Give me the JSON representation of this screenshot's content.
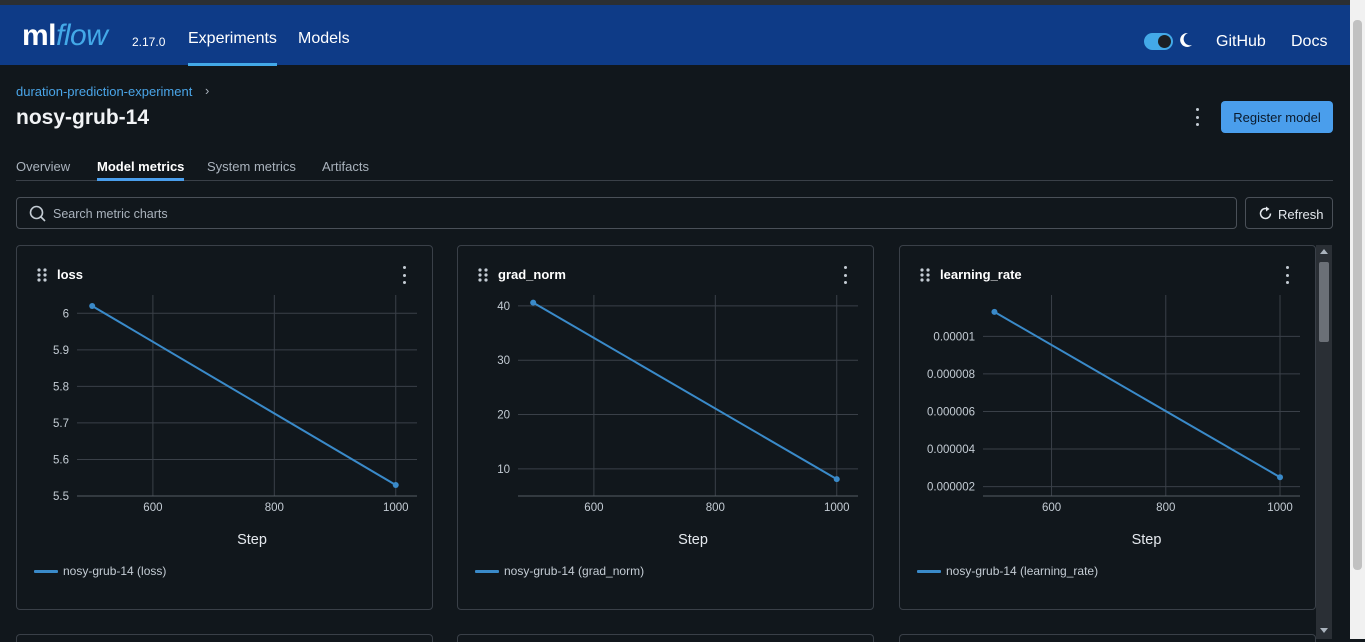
{
  "header": {
    "logo_main": "ml",
    "logo_flow": "flow",
    "version": "2.17.0",
    "nav": [
      {
        "label": "Experiments",
        "active": true
      },
      {
        "label": "Models",
        "active": false
      }
    ],
    "theme_toggle_on": true,
    "links": [
      "GitHub",
      "Docs"
    ]
  },
  "breadcrumb": {
    "experiment": "duration-prediction-experiment"
  },
  "run": {
    "name": "nosy-grub-14",
    "register_label": "Register model"
  },
  "tabs": [
    {
      "label": "Overview",
      "active": false
    },
    {
      "label": "Model metrics",
      "active": true
    },
    {
      "label": "System metrics",
      "active": false
    },
    {
      "label": "Artifacts",
      "active": false
    }
  ],
  "search": {
    "placeholder": "Search metric charts"
  },
  "refresh_label": "Refresh",
  "colors": {
    "accent": "#43a9e8",
    "series": "#3a8ac9",
    "header_bg": "#0e3b87"
  },
  "chart_data": [
    {
      "type": "line",
      "title": "loss",
      "xlabel": "Step",
      "ylabel": "",
      "x": [
        500,
        1000
      ],
      "series": [
        {
          "name": "nosy-grub-14 (loss)",
          "values": [
            6.02,
            5.53
          ]
        }
      ],
      "xlim": [
        475,
        1035
      ],
      "ylim": [
        5.5,
        6.05
      ],
      "xticks": [
        "600",
        "800",
        "1000"
      ],
      "xtick_values": [
        600,
        800,
        1000
      ],
      "yticks": [
        "5.5",
        "5.6",
        "5.7",
        "5.8",
        "5.9",
        "6"
      ],
      "ytick_values": [
        5.5,
        5.6,
        5.7,
        5.8,
        5.9,
        6.0
      ],
      "grid": true,
      "legend": "bottom-left"
    },
    {
      "type": "line",
      "title": "grad_norm",
      "xlabel": "Step",
      "ylabel": "",
      "x": [
        500,
        1000
      ],
      "series": [
        {
          "name": "nosy-grub-14 (grad_norm)",
          "values": [
            40.6,
            8.1
          ]
        }
      ],
      "xlim": [
        475,
        1035
      ],
      "ylim": [
        5,
        42
      ],
      "xticks": [
        "600",
        "800",
        "1000"
      ],
      "xtick_values": [
        600,
        800,
        1000
      ],
      "yticks": [
        "10",
        "20",
        "30",
        "40"
      ],
      "ytick_values": [
        10,
        20,
        30,
        40
      ],
      "grid": true,
      "legend": "bottom-left"
    },
    {
      "type": "line",
      "title": "learning_rate",
      "xlabel": "Step",
      "ylabel": "",
      "x": [
        500,
        1000
      ],
      "series": [
        {
          "name": "nosy-grub-14 (learning_rate)",
          "values": [
            1.13e-05,
            2.5e-06
          ]
        }
      ],
      "xlim": [
        480,
        1035
      ],
      "ylim": [
        1.5e-06,
        1.22e-05
      ],
      "xticks": [
        "600",
        "800",
        "1000"
      ],
      "xtick_values": [
        600,
        800,
        1000
      ],
      "yticks": [
        "0.000002",
        "0.000004",
        "0.000006",
        "0.000008",
        "0.00001"
      ],
      "ytick_values": [
        2e-06,
        4e-06,
        6e-06,
        8e-06,
        1e-05
      ],
      "grid": true,
      "legend": "bottom-left"
    }
  ]
}
